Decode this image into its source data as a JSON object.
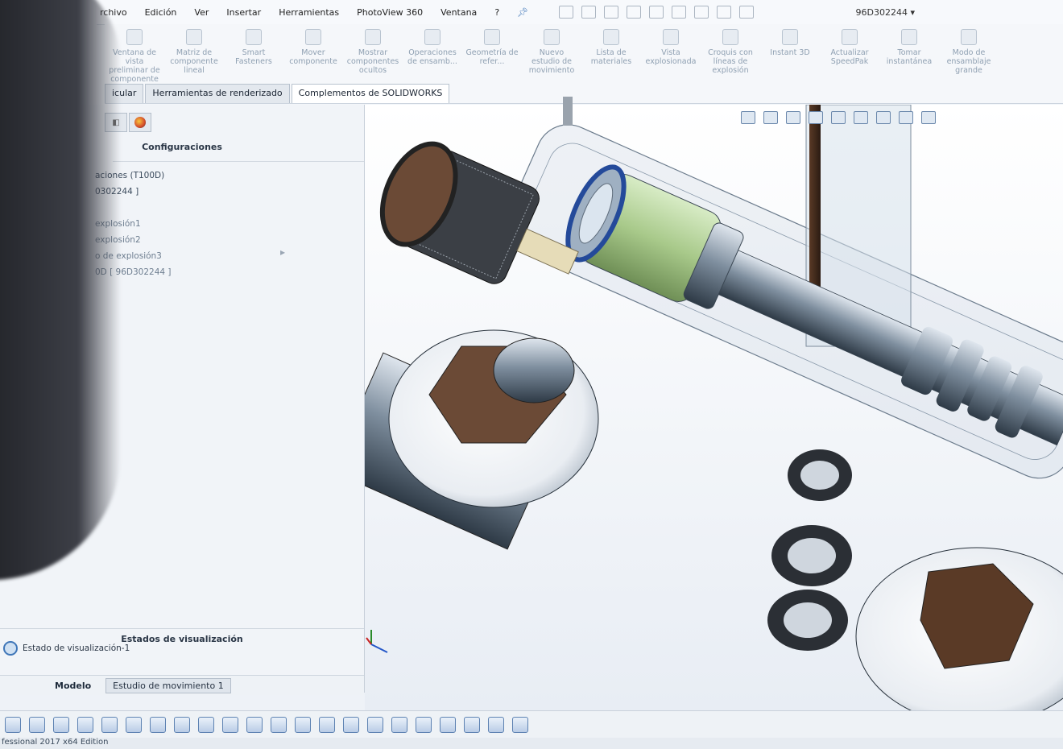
{
  "menu": {
    "items": [
      "rchivo",
      "Edición",
      "Ver",
      "Insertar",
      "Herramientas",
      "PhotoView 360",
      "Ventana",
      "?"
    ],
    "config_id": "96D302244 ▾"
  },
  "ribbon": {
    "buttons": [
      "Ventana de vista preliminar de componente",
      "Matriz de componente lineal",
      "Smart Fasteners",
      "Mover componente",
      "Mostrar componentes ocultos",
      "Operaciones de ensamb...",
      "Geometría de refer...",
      "Nuevo estudio de movimiento",
      "Lista de materiales",
      "Vista explosionada",
      "Croquis con líneas de explosión",
      "Instant 3D",
      "Actualizar SpeedPak",
      "Tomar instantánea",
      "Modo de ensamblaje grande"
    ]
  },
  "tabs": [
    "icular",
    "Herramientas de renderizado",
    "Complementos de SOLIDWORKS"
  ],
  "left_panel": {
    "title": "Configuraciones",
    "tree": [
      "aciones  (T100D)",
      "0302244 ]",
      "explosión1",
      "explosión2",
      "o de explosión3",
      "0D [ 96D302244 ]"
    ],
    "display_states_title": "Estados de visualización",
    "display_state_item": "Estado de visualización-1"
  },
  "bottom_tabs": {
    "model": "Modelo",
    "study": "Estudio de movimiento 1"
  },
  "statusbar": {
    "text": "fessional 2017 x64 Edition"
  },
  "colors": {
    "accent": "#3f76b8",
    "background": "#eef2f7"
  }
}
